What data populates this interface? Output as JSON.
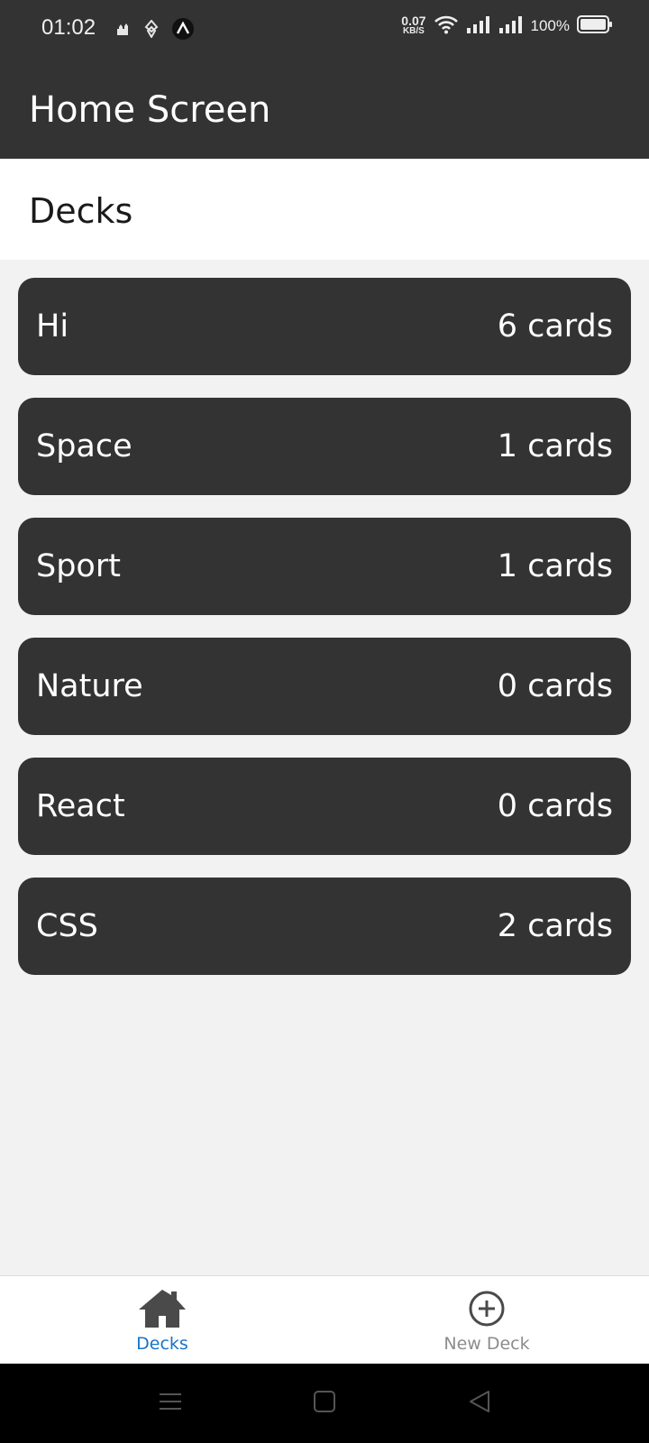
{
  "status_bar": {
    "time": "01:02",
    "net_speed_value": "0.07",
    "net_speed_unit": "KB/S",
    "battery_percent": "100%"
  },
  "header": {
    "title": "Home Screen"
  },
  "section": {
    "title": "Decks"
  },
  "decks": [
    {
      "name": "Hi",
      "count": "6 cards"
    },
    {
      "name": "Space",
      "count": "1 cards"
    },
    {
      "name": "Sport",
      "count": "1 cards"
    },
    {
      "name": "Nature",
      "count": "0 cards"
    },
    {
      "name": "React",
      "count": "0 cards"
    },
    {
      "name": "CSS",
      "count": "2 cards"
    }
  ],
  "tabs": [
    {
      "label": "Decks",
      "icon": "home-icon",
      "active": true
    },
    {
      "label": "New Deck",
      "icon": "plus-circle-icon",
      "active": false
    }
  ],
  "colors": {
    "header_bg": "#333333",
    "card_bg": "#333333",
    "active_tab": "#1a73c8",
    "inactive_tab": "#8c8c8c",
    "page_bg": "#f2f2f2"
  }
}
